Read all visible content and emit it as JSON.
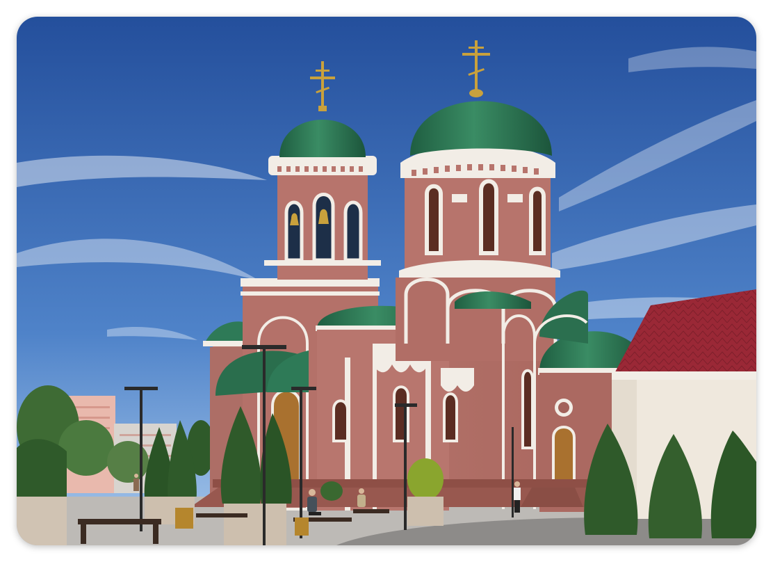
{
  "image": {
    "kind": "photo-illustration",
    "subject": "church",
    "text": ""
  },
  "colors": {
    "sky_top": "#2b5aa6",
    "sky_bottom": "#9ec2ea",
    "brick": "#b8766e",
    "brick_dark": "#9c5c55",
    "trim": "#f2ede6",
    "dome": "#2e7a57",
    "dome_dark": "#1e5a3f",
    "roof_red": "#9a2836",
    "cross_gold": "#c9a13c",
    "pavement": "#bdbab6",
    "tree": "#2f5a2a"
  }
}
